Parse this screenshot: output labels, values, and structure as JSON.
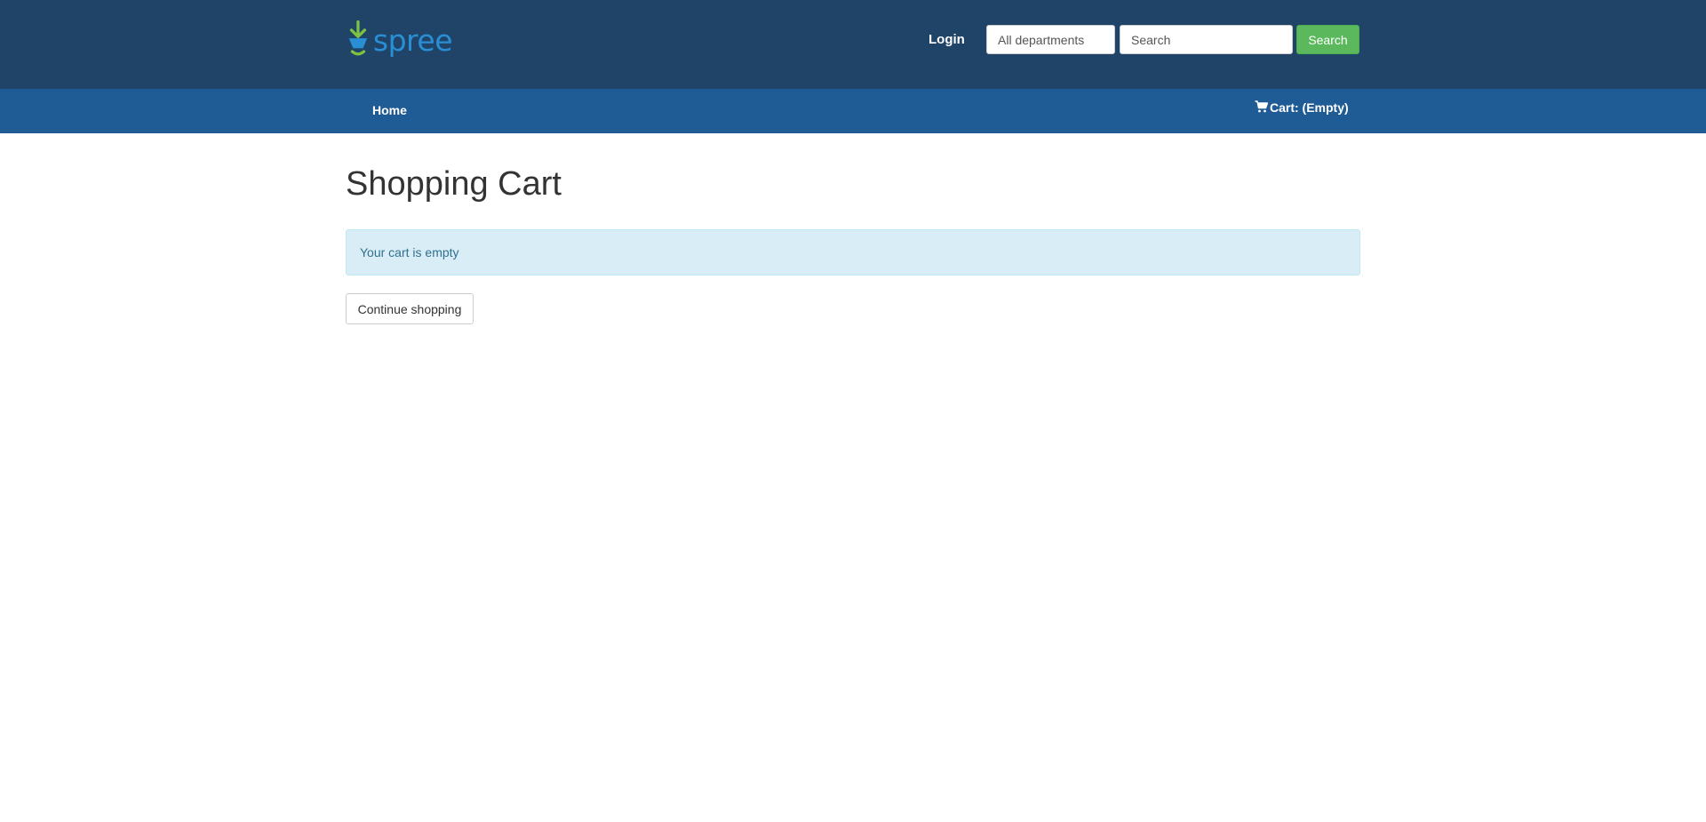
{
  "header": {
    "logo_text": "spree",
    "login_label": "Login",
    "department_select": {
      "selected": "All departments"
    },
    "search": {
      "placeholder": "Search",
      "value": ""
    },
    "search_button_label": "Search"
  },
  "nav": {
    "home_label": "Home",
    "cart_label": "Cart: (Empty)",
    "cart_icon": "shopping-cart-icon"
  },
  "main": {
    "title": "Shopping Cart",
    "empty_message": "Your cart is empty",
    "continue_label": "Continue shopping"
  },
  "colors": {
    "header_bg": "#1f4468",
    "nav_bg": "#1f5b94",
    "search_button_bg": "#5cb85c",
    "alert_bg": "#d9edf7",
    "alert_text": "#31708f",
    "logo_blue": "#2a8ed4",
    "logo_green": "#7dc242"
  }
}
